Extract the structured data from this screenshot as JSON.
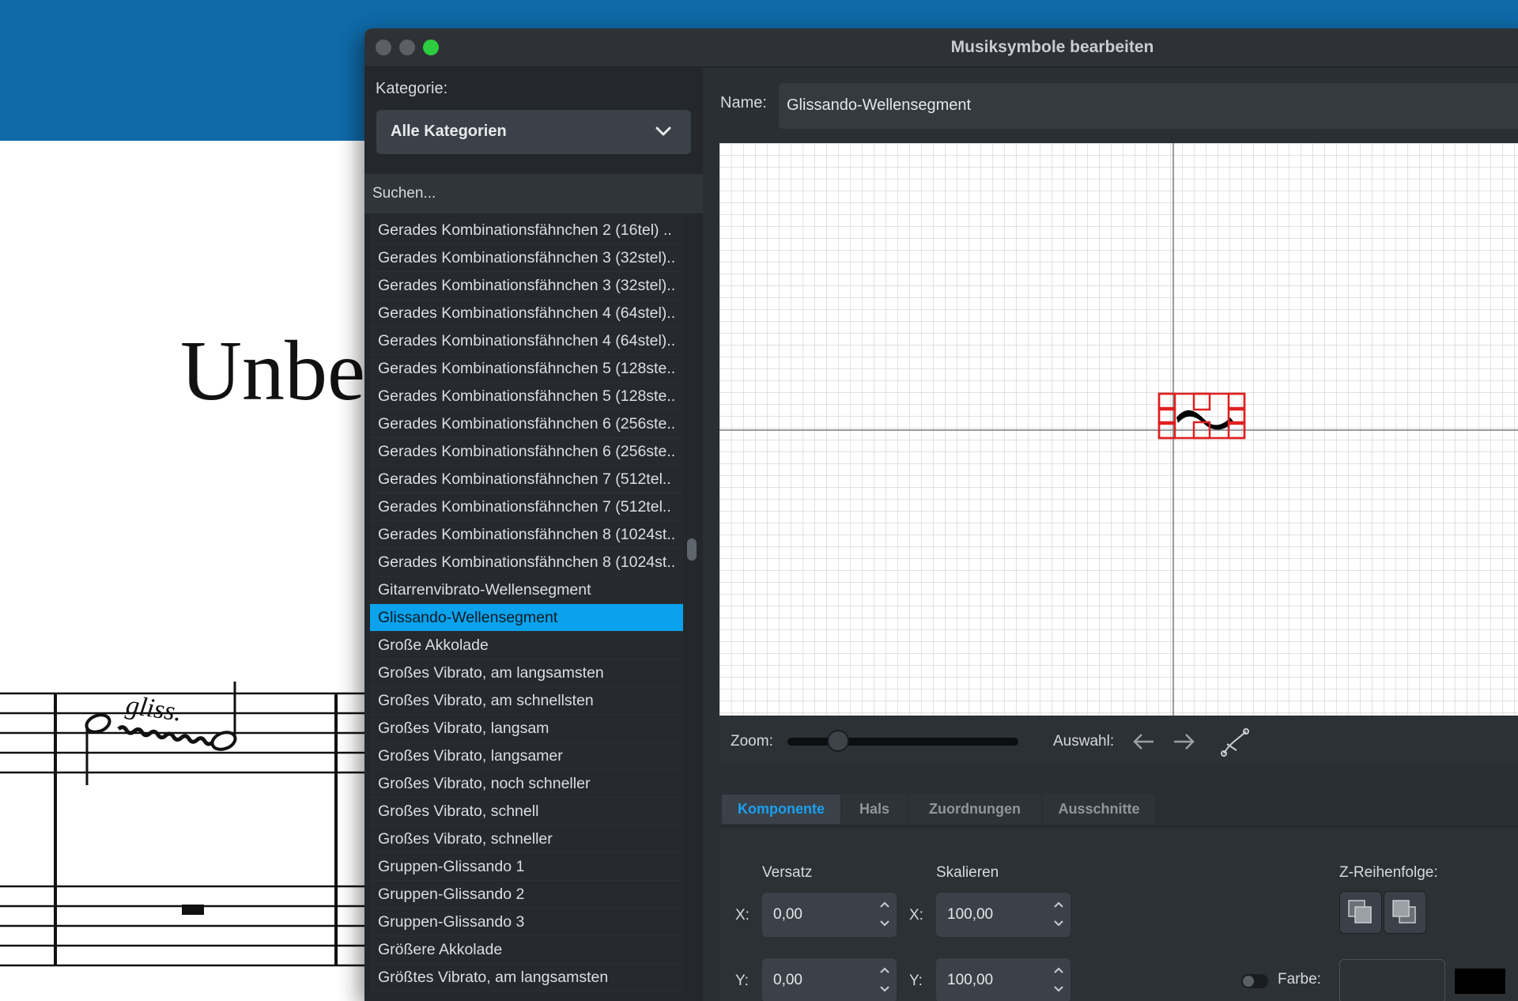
{
  "window": {
    "title": "Musiksymbole bearbeiten"
  },
  "background_score": {
    "title_fragment": "Unbe",
    "gliss_text": "gliss."
  },
  "left_panel": {
    "category_label": "Kategorie:",
    "category_value": "Alle Kategorien",
    "search_placeholder": "Suchen...",
    "items": [
      "Gerades Kombinationsfähnchen 2 (16tel) ..",
      "Gerades Kombinationsfähnchen 3 (32stel)..",
      "Gerades Kombinationsfähnchen 3 (32stel)..",
      "Gerades Kombinationsfähnchen 4 (64stel)..",
      "Gerades Kombinationsfähnchen 4 (64stel)..",
      "Gerades Kombinationsfähnchen 5 (128ste..",
      "Gerades Kombinationsfähnchen 5 (128ste..",
      "Gerades Kombinationsfähnchen 6 (256ste..",
      "Gerades Kombinationsfähnchen 6 (256ste..",
      "Gerades Kombinationsfähnchen 7 (512tel..",
      "Gerades Kombinationsfähnchen 7 (512tel..",
      "Gerades Kombinationsfähnchen 8 (1024st..",
      "Gerades Kombinationsfähnchen 8 (1024st..",
      "Gitarrenvibrato-Wellensegment",
      "Glissando-Wellensegment",
      "Große Akkolade",
      "Großes Vibrato, am langsamsten",
      "Großes Vibrato, am schnellsten",
      "Großes Vibrato, langsam",
      "Großes Vibrato, langsamer",
      "Großes Vibrato, noch schneller",
      "Großes Vibrato, schnell",
      "Großes Vibrato, schneller",
      "Gruppen-Glissando 1",
      "Gruppen-Glissando 2",
      "Gruppen-Glissando 3",
      "Größere Akkolade",
      "Größtes Vibrato, am langsamsten"
    ],
    "selected_index": 14
  },
  "right_panel": {
    "name_label": "Name:",
    "name_value": "Glissando-Wellensegment",
    "zoom_label": "Zoom:",
    "zoom_level": 0.22,
    "selection_label": "Auswahl:",
    "prev_icon": "arrow-left-icon",
    "next_icon": "arrow-right-icon",
    "edit_icon": "bezier-curve-icon",
    "tabs": [
      "Komponente",
      "Hals",
      "Zuordnungen",
      "Ausschnitte"
    ],
    "active_tab": 0,
    "offset_header": "Versatz",
    "scale_header": "Skalieren",
    "z_order_header": "Z-Reihenfolge:",
    "x_label": "X:",
    "y_label": "Y:",
    "offset_x": "0,00",
    "offset_y": "0,00",
    "scale_x": "100,00",
    "scale_y": "100,00",
    "color_label": "Farbe:",
    "color_value": "#000000",
    "selection_color": "#e02020"
  }
}
